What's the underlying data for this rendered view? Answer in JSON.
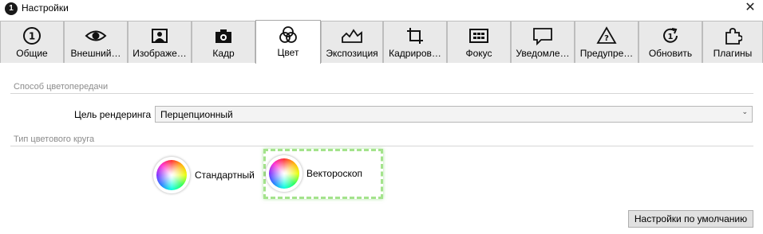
{
  "window": {
    "title": "Настройки",
    "app_icon_text": "1"
  },
  "tabs": [
    {
      "label": "Общие",
      "icon": "info-circle-icon"
    },
    {
      "label": "Внешний…",
      "icon": "eye-icon"
    },
    {
      "label": "Изображе…",
      "icon": "portrait-icon"
    },
    {
      "label": "Кадр",
      "icon": "camera-icon"
    },
    {
      "label": "Цвет",
      "icon": "color-circles-icon",
      "active": true
    },
    {
      "label": "Экспозиция",
      "icon": "histogram-icon"
    },
    {
      "label": "Кадриров…",
      "icon": "crop-icon"
    },
    {
      "label": "Фокус",
      "icon": "focus-grid-icon"
    },
    {
      "label": "Уведомле…",
      "icon": "speech-bubble-icon"
    },
    {
      "label": "Предупре…",
      "icon": "warning-triangle-icon"
    },
    {
      "label": "Обновить",
      "icon": "update-icon"
    },
    {
      "label": "Плагины",
      "icon": "puzzle-icon"
    }
  ],
  "color_rendering": {
    "group_title": "Способ цветопередачи",
    "render_label": "Цель рендеринга",
    "render_value": "Перцепционный"
  },
  "color_wheel": {
    "group_title": "Тип цветового круга",
    "options": [
      {
        "label": "Стандартный",
        "selected": false
      },
      {
        "label": "Вектороскоп",
        "selected": true
      }
    ],
    "selection_color": "#a4e38c"
  },
  "footer": {
    "defaults_button": "Настройки по умолчанию"
  }
}
